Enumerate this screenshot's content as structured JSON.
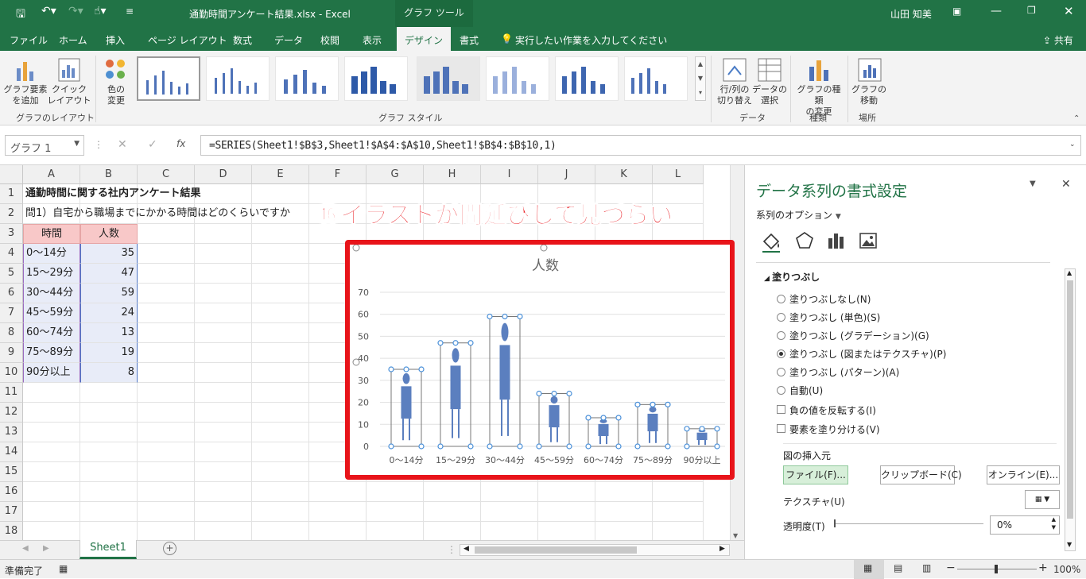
{
  "titlebar": {
    "filename": "通勤時間アンケート結果.xlsx",
    "app": "Excel",
    "context_tab": "グラフ ツール",
    "user": "山田 知美"
  },
  "tabs": [
    "ファイル",
    "ホーム",
    "挿入",
    "ページ レイアウト",
    "数式",
    "データ",
    "校閲",
    "表示",
    "デザイン",
    "書式"
  ],
  "tell_me": "実行したい作業を入力してください",
  "share": "共有",
  "ribbon": {
    "add_element": "グラフ要素\nを追加",
    "quick_layout": "クイック\nレイアウト",
    "layout_group": "グラフのレイアウト",
    "change_color": "色の\n変更",
    "style_group": "グラフ スタイル",
    "switch_row_col": "行/列の\n切り替え",
    "select_data": "データの\n選択",
    "data_group": "データ",
    "change_type": "グラフの種類\nの変更",
    "type_group": "種類",
    "move_chart": "グラフの\n移動",
    "location_group": "場所"
  },
  "formula_bar": {
    "name_box": "グラフ 1",
    "fx": "fx",
    "formula": "=SERIES(Sheet1!$B$3,Sheet1!$A$4:$A$10,Sheet1!$B$4:$B$10,1)"
  },
  "columns": [
    "A",
    "B",
    "C",
    "D",
    "E",
    "F",
    "G",
    "H",
    "I",
    "J",
    "K",
    "L"
  ],
  "rows": [
    "1",
    "2",
    "3",
    "4",
    "5",
    "6",
    "7",
    "8",
    "9",
    "10",
    "11",
    "12",
    "13",
    "14",
    "15",
    "16",
    "17",
    "18"
  ],
  "sheet": {
    "a1": "通勤時間に関する社内アンケート結果",
    "a2": "問1）自宅から職場までにかかる時間はどのくらいですか",
    "header_time": "時間",
    "header_count": "人数",
    "table": [
      {
        "time": "0～14分",
        "count": "35"
      },
      {
        "time": "15～29分",
        "count": "47"
      },
      {
        "time": "30～44分",
        "count": "59"
      },
      {
        "time": "45～59分",
        "count": "24"
      },
      {
        "time": "60～74分",
        "count": "13"
      },
      {
        "time": "75～89分",
        "count": "19"
      },
      {
        "time": "90分以上",
        "count": "8"
      }
    ]
  },
  "sheet_tab": "Sheet1",
  "status": {
    "ready": "準備完了",
    "zoom": "100%"
  },
  "annotation": "⑯イラストが間延びして見づらい",
  "pane": {
    "title": "データ系列の書式設定",
    "series_options": "系列のオプション",
    "fill_section": "塗りつぶし",
    "fill_options": [
      "塗りつぶしなし(N)",
      "塗りつぶし (単色)(S)",
      "塗りつぶし (グラデーション)(G)",
      "塗りつぶし (図またはテクスチャ)(P)",
      "塗りつぶし (パターン)(A)",
      "自動(U)"
    ],
    "invert_negative": "負の値を反転する(I)",
    "vary_colors": "要素を塗り分ける(V)",
    "insert_from": "図の挿入元",
    "file_btn": "ファイル(F)...",
    "clipboard_btn": "クリップボード(C)",
    "online_btn": "オンライン(E)...",
    "texture": "テクスチャ(U)",
    "transparency": "透明度(T)",
    "transparency_value": "0%"
  },
  "chart_data": {
    "type": "bar",
    "title": "人数",
    "categories": [
      "0～14分",
      "15～29分",
      "30～44分",
      "45～59分",
      "60～74分",
      "75～89分",
      "90分以上"
    ],
    "values": [
      35,
      47,
      59,
      24,
      13,
      19,
      8
    ],
    "ylim": [
      0,
      70
    ],
    "yticks": [
      "0",
      "10",
      "20",
      "30",
      "40",
      "50",
      "60",
      "70"
    ],
    "fill": "picture (person icon)",
    "bar_color": "#5b7fbf",
    "grid": true
  },
  "colors": {
    "excel_green": "#217346",
    "annotation_red": "#e8141a",
    "header_fill": "#f8c8c8",
    "data_fill": "#e8ecf8"
  }
}
